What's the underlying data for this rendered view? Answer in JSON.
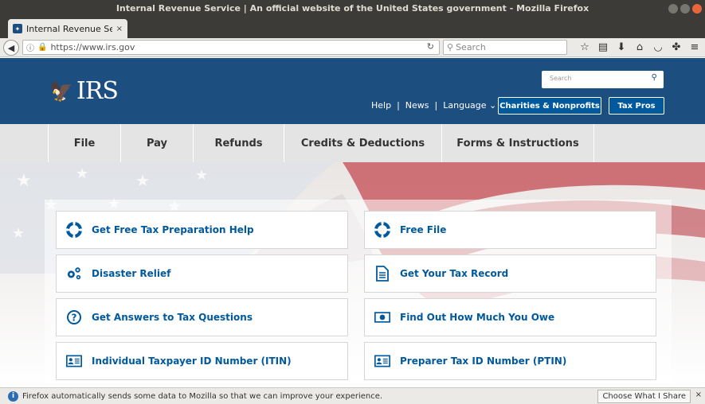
{
  "window": {
    "title": "Internal Revenue Service | An official website of the United States government - Mozilla Firefox"
  },
  "tab": {
    "label": "Internal Revenue Servic",
    "close": "×",
    "new": "+"
  },
  "navbar": {
    "url": "https://www.irs.gov",
    "search_placeholder": "Search"
  },
  "irs": {
    "logo_text": "IRS",
    "search_placeholder": "Search",
    "utility": {
      "help": "Help",
      "news": "News",
      "language": "Language ⌄",
      "sep": "|"
    },
    "buttons": {
      "charities": "Charities & Nonprofits",
      "taxpros": "Tax Pros"
    }
  },
  "mainnav": [
    "File",
    "Pay",
    "Refunds",
    "Credits & Deductions",
    "Forms & Instructions"
  ],
  "quicklinks": [
    {
      "label": "Get Free Tax Preparation Help",
      "icon": "lifebuoy-icon"
    },
    {
      "label": "Free File",
      "icon": "lifebuoy-icon"
    },
    {
      "label": "Disaster Relief",
      "icon": "gears-icon"
    },
    {
      "label": "Get Your Tax Record",
      "icon": "document-icon"
    },
    {
      "label": "Get Answers to Tax Questions",
      "icon": "question-circle-icon"
    },
    {
      "label": "Find Out How Much You Owe",
      "icon": "money-icon"
    },
    {
      "label": "Individual Taxpayer ID Number (ITIN)",
      "icon": "id-card-icon"
    },
    {
      "label": "Preparer Tax ID Number (PTIN)",
      "icon": "id-card-icon"
    }
  ],
  "notification": {
    "text": "Firefox automatically sends some data to Mozilla so that we can improve your experience.",
    "button": "Choose What I Share",
    "close": "×"
  },
  "colors": {
    "irs_blue": "#1c4e80",
    "link_blue": "#00599c",
    "button_blue": "#00599c"
  }
}
